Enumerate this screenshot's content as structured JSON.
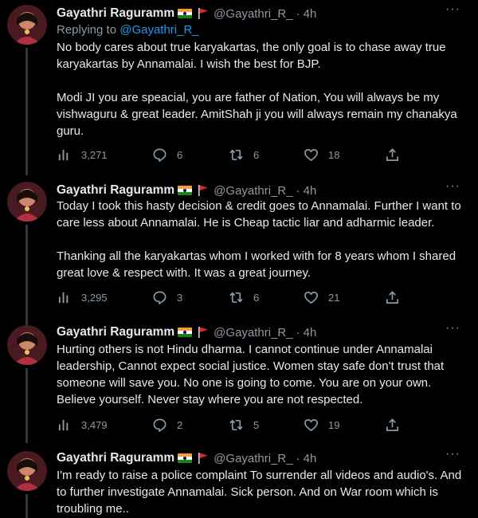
{
  "tweets": [
    {
      "name": "Gayathri Raguramm",
      "handle": "@Gayathri_R_",
      "separator": "·",
      "time": "4h",
      "replying_label": "Replying to",
      "replying_to": "@Gayathri_R_",
      "text": "No body cares about true karyakartas, the only goal is to chase away true karyakartas by Annamalai. I wish the best for BJP.\n\nModi JI you are speacial, you are father of Nation, You will always be my vishwaguru & great leader. AmitShah ji you will always remain my chanakya guru.",
      "views": "3,271",
      "replies": "6",
      "retweets": "6",
      "likes": "18"
    },
    {
      "name": "Gayathri Raguramm",
      "handle": "@Gayathri_R_",
      "separator": "·",
      "time": "4h",
      "text": "Today I took this hasty decision & credit goes to Annamalai. Further I want to care less about Annamalai. He is Cheap tactic liar and adharmic leader.\n\nThanking all the karyakartas whom I worked with for 8 years whom I shared great love & respect with. It was a great journey.",
      "views": "3,295",
      "replies": "3",
      "retweets": "6",
      "likes": "21"
    },
    {
      "name": "Gayathri Raguramm",
      "handle": "@Gayathri_R_",
      "separator": "·",
      "time": "4h",
      "text": "Hurting others is not Hindu dharma. I cannot continue under Annamalai leadership, Cannot expect social justice. Women stay safe don't trust that someone will save you. No one is going to come. You are on your own. Believe yourself. Never stay where you are not respected.",
      "views": "3,479",
      "replies": "2",
      "retweets": "5",
      "likes": "19"
    },
    {
      "name": "Gayathri Raguramm",
      "handle": "@Gayathri_R_",
      "separator": "·",
      "time": "4h",
      "text": "I'm ready to raise a police complaint To surrender all videos and audio's. And to further investigate Annamalai. Sick person. And on War room which is troubling me.."
    }
  ],
  "icons": {
    "views": "bar-chart-icon",
    "reply": "speech-bubble-icon",
    "retweet": "retweet-icon",
    "like": "heart-icon",
    "share": "share-icon",
    "more": "more-dots-icon"
  },
  "colors": {
    "background": "#000000",
    "text": "#e7e9ea",
    "secondary": "#8b98a5",
    "link": "#1d9bf0",
    "thread_line": "#333639"
  }
}
